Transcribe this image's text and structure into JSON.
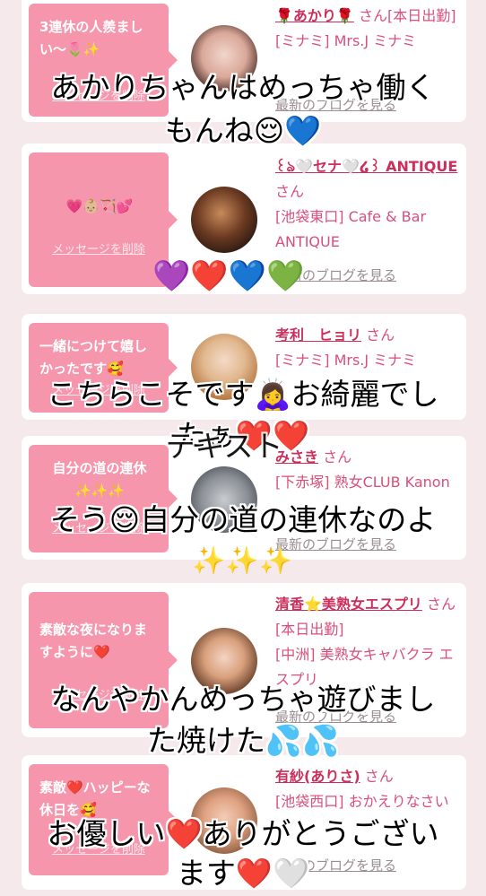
{
  "delete_label": "メッセージを削除",
  "blog_label": "最新のブログを見る",
  "entries": [
    {
      "message": "3連休の人羨ましい〜🌷✨",
      "name": "🌹あかり🌹",
      "suffix": "さん[本日出勤]",
      "shop": "[ミナミ] Mrs.J ミナミ"
    },
    {
      "message": "💗👶🏼🏹💕",
      "name": "꒰ঌ🤍セナ🤍໒꒱ ANTIQUE",
      "suffix": "さん",
      "shop": "[池袋東口] Cafe & Bar ANTIQUE"
    },
    {
      "message": "一緒につけて嬉しかったです🥰",
      "name": "考利　ヒョリ",
      "suffix": "さん",
      "shop": "[ミナミ] Mrs.J ミナミ"
    },
    {
      "message": "自分の道の連休✨✨✨",
      "name": "みさき",
      "suffix": "さん",
      "shop": "[下赤塚] 熟女CLUB Kanon"
    },
    {
      "message": "素敵な夜になりますように❤️",
      "name": "清香⭐美熟女エスプリ",
      "suffix": "さん[本日出勤]",
      "shop": "[中洲] 美熟女キャバクラ エスプリ"
    },
    {
      "message": "素敵❤️ハッピーな休日を🥰",
      "name": "有紗(ありさ)",
      "suffix": "さん",
      "shop": "[池袋西口] おかえりなさい"
    }
  ],
  "overlays": [
    "あかりちゃんはめっちゃ働く",
    "もんね😌💙",
    "💜❤️💙💚",
    "こちらこそです🙇‍♀️お綺麗でし",
    "たぁ❤️❤️",
    "テキスト",
    "そう😌自分の道の連休なのよ",
    "✨✨✨",
    "なんやかんめっちゃ遊びまし",
    "た焼けた💦💦",
    "お優しい❤️ありがとうござい",
    "ます❤️🤍"
  ]
}
